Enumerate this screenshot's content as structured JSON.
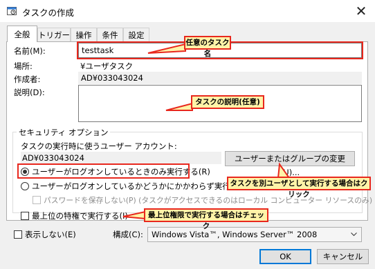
{
  "window": {
    "title": "タスクの作成",
    "close_glyph": "✕"
  },
  "tabs": [
    "全般",
    "トリガー",
    "操作",
    "条件",
    "設定"
  ],
  "general": {
    "name_label": "名前(M):",
    "name_value": "testtask",
    "location_label": "場所:",
    "location_value": "¥ユーザタスク",
    "author_label": "作成者:",
    "author_value": "AD¥033043024",
    "description_label": "説明(D):",
    "description_value": ""
  },
  "security": {
    "group_title": "セキュリティ オプション",
    "account_prompt": "タスクの実行時に使うユーザー アカウント:",
    "account_value": "AD¥033043024",
    "change_button": "ユーザーまたはグループの変更(U)...",
    "radio_logged_on_only": "ユーザーがログオンしているときのみ実行する(R)",
    "radio_whether_logged_on": "ユーザーがログオンしているかどうかにかかわらず実行する(W)",
    "no_store_password": "パスワードを保存しない(P) (タスクがアクセスできるのはローカル コンピューター リソースのみ)",
    "highest_privileges": "最上位の特権で実行する(I)"
  },
  "bottom": {
    "hidden_label": "表示しない(E)",
    "configure_label": "構成(C):",
    "configure_value": "Windows Vista™, Windows Server™ 2008",
    "ok_button": "OK",
    "cancel_button": "キャンセル"
  },
  "annotations": {
    "task_name": "任意のタスク名",
    "task_description": "タスクの説明(任意)",
    "run_as_other_user": "タスクを別ユーザとして実行する場合はクリック",
    "highest_privilege": "最上位権限で実行する場合はチェック"
  },
  "state": {
    "selected_radio": "logged_on_only",
    "no_store_password_checked": false,
    "highest_privileges_checked": false,
    "hidden_checked": false
  },
  "colors": {
    "callout_fill": "#fff3a8",
    "callout_border": "#e8271d",
    "accent": "#0078d7"
  }
}
